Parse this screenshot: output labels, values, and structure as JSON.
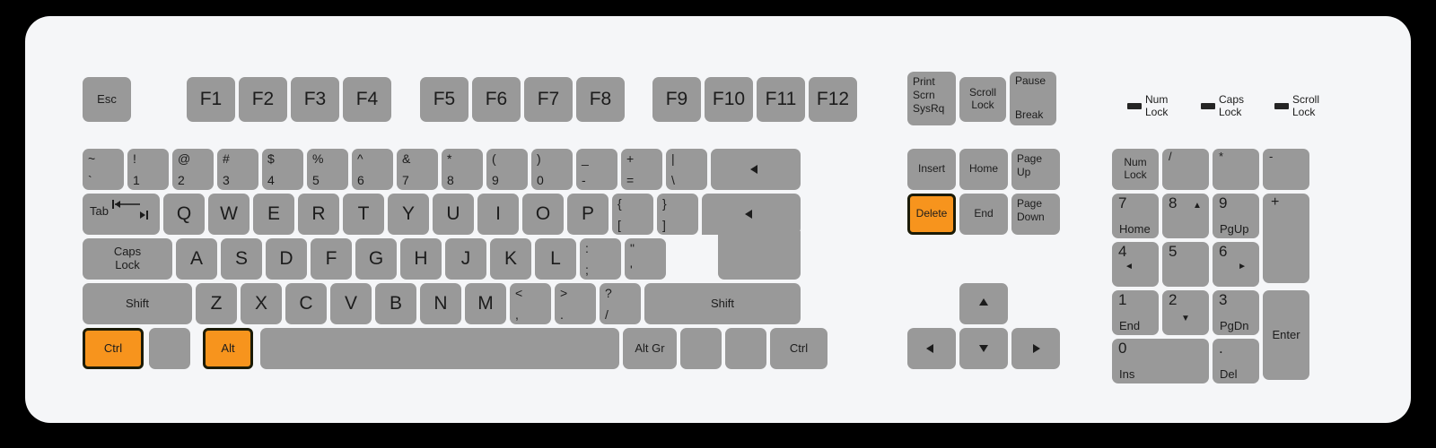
{
  "device": {
    "name": "pc-keyboard-105-diagram",
    "body_color": "#f5f6f8",
    "key_color": "#999999",
    "highlight_color": "#f7941d",
    "highlight_border_color": "#1b1b07",
    "text_color": "#1c1c1c",
    "background_color": "#000000"
  },
  "highlighted_keys": [
    "Ctrl",
    "Alt",
    "Delete"
  ],
  "function_row": {
    "esc": "Esc",
    "group1": [
      "F1",
      "F2",
      "F3",
      "F4"
    ],
    "group2": [
      "F5",
      "F6",
      "F7",
      "F8"
    ],
    "group3": [
      "F9",
      "F10",
      "F11",
      "F12"
    ]
  },
  "number_row": [
    {
      "top": "~",
      "bottom": "`"
    },
    {
      "top": "!",
      "bottom": "1"
    },
    {
      "top": "@",
      "bottom": "2"
    },
    {
      "top": "#",
      "bottom": "3"
    },
    {
      "top": "$",
      "bottom": "4"
    },
    {
      "top": "%",
      "bottom": "5"
    },
    {
      "top": "^",
      "bottom": "6"
    },
    {
      "top": "&",
      "bottom": "7"
    },
    {
      "top": "*",
      "bottom": "8"
    },
    {
      "top": "(",
      "bottom": "9"
    },
    {
      "top": ")",
      "bottom": "0"
    },
    {
      "top": "_",
      "bottom": "-"
    },
    {
      "top": "+",
      "bottom": "="
    },
    {
      "top": "|",
      "bottom": "\\"
    }
  ],
  "backspace": {
    "label": "",
    "icon": "left-triangle-icon"
  },
  "tab_row": {
    "tab": {
      "label": "Tab",
      "icon": "tab-arrows-icon"
    },
    "letters": [
      "Q",
      "W",
      "E",
      "R",
      "T",
      "Y",
      "U",
      "I",
      "O",
      "P"
    ],
    "brackets": [
      {
        "top": "{",
        "bottom": "["
      },
      {
        "top": "}",
        "bottom": "]"
      }
    ]
  },
  "enter": {
    "label": "",
    "icon": "left-triangle-icon"
  },
  "home_row": {
    "caps_lock": "Caps\nLock",
    "letters": [
      "A",
      "S",
      "D",
      "F",
      "G",
      "H",
      "J",
      "K",
      "L"
    ],
    "punct": [
      {
        "top": ":",
        "bottom": ";"
      },
      {
        "top": "\"",
        "bottom": "'"
      }
    ]
  },
  "shift_row": {
    "shift_left": "Shift",
    "letters": [
      "Z",
      "X",
      "C",
      "V",
      "B",
      "N",
      "M"
    ],
    "punct": [
      {
        "top": "<",
        "bottom": ","
      },
      {
        "top": ">",
        "bottom": "."
      },
      {
        "top": "?",
        "bottom": "/"
      }
    ],
    "shift_right": "Shift"
  },
  "bottom_row": {
    "ctrl_left": "Ctrl",
    "meta_left": "",
    "alt_left": "Alt",
    "space": "",
    "alt_gr": "Alt Gr",
    "meta_right": "",
    "menu": "",
    "ctrl_right": "Ctrl"
  },
  "system_cluster": {
    "print_screen": "Print\nScrn\nSysRq",
    "scroll_lock": "Scroll\nLock",
    "pause": "Pause",
    "break": "Break"
  },
  "nav_cluster": {
    "insert": "Insert",
    "home": "Home",
    "page_up": "Page\nUp",
    "delete": "Delete",
    "end": "End",
    "page_down": "Page\nDown"
  },
  "arrow_cluster": {
    "up": {
      "label": "",
      "icon": "arrow-up-icon"
    },
    "left": {
      "label": "",
      "icon": "arrow-left-icon"
    },
    "down": {
      "label": "",
      "icon": "arrow-down-icon"
    },
    "right": {
      "label": "",
      "icon": "arrow-right-icon"
    }
  },
  "indicator_leds": [
    {
      "label": "Num\nLock",
      "state": "off"
    },
    {
      "label": "Caps\nLock",
      "state": "off"
    },
    {
      "label": "Scroll\nLock",
      "state": "off"
    }
  ],
  "numpad": {
    "num_lock": "Num\nLock",
    "divide": "/",
    "multiply": "*",
    "subtract": "-",
    "add": "+",
    "enter": "Enter",
    "keys": [
      {
        "num": "7",
        "fn": "Home",
        "arrow": ""
      },
      {
        "num": "8",
        "fn": "",
        "arrow": "▲"
      },
      {
        "num": "9",
        "fn": "PgUp",
        "arrow": ""
      },
      {
        "num": "4",
        "fn": "",
        "arrow": "◄"
      },
      {
        "num": "5",
        "fn": "",
        "arrow": ""
      },
      {
        "num": "6",
        "fn": "",
        "arrow": "►"
      },
      {
        "num": "1",
        "fn": "End",
        "arrow": ""
      },
      {
        "num": "2",
        "fn": "",
        "arrow": "▼"
      },
      {
        "num": "3",
        "fn": "PgDn",
        "arrow": ""
      },
      {
        "num": "0",
        "fn": "Ins",
        "arrow": ""
      },
      {
        "num": ".",
        "fn": "Del",
        "arrow": ""
      }
    ]
  }
}
